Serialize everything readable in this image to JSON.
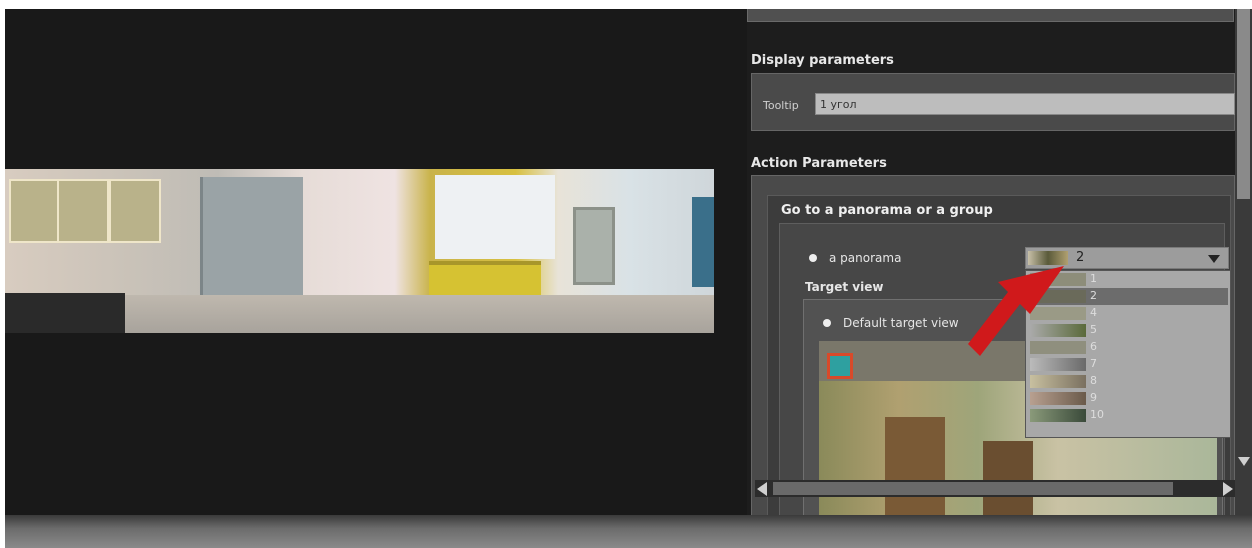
{
  "panel": {
    "display_section_title": "Display parameters",
    "tooltip_label": "Tooltip",
    "tooltip_value": "1 угол",
    "action_section_title": "Action Parameters",
    "group_title": "Go to a panorama or a group",
    "option_panorama_label": "a panorama",
    "selected_panorama": "2",
    "target_view_label": "Target view",
    "option_default_view_label": "Default target view"
  },
  "dropdown": {
    "items": [
      {
        "label": "1"
      },
      {
        "label": "2",
        "selected": true
      },
      {
        "label": "4"
      },
      {
        "label": "5"
      },
      {
        "label": "6"
      },
      {
        "label": "7"
      },
      {
        "label": "8"
      },
      {
        "label": "9"
      },
      {
        "label": "10"
      }
    ]
  },
  "colors": {
    "annotation_arrow": "#d0191b",
    "background": "#191919"
  },
  "icons": {
    "dropdown": "chevron-down-icon",
    "annotation": "arrow-pointer-icon"
  }
}
